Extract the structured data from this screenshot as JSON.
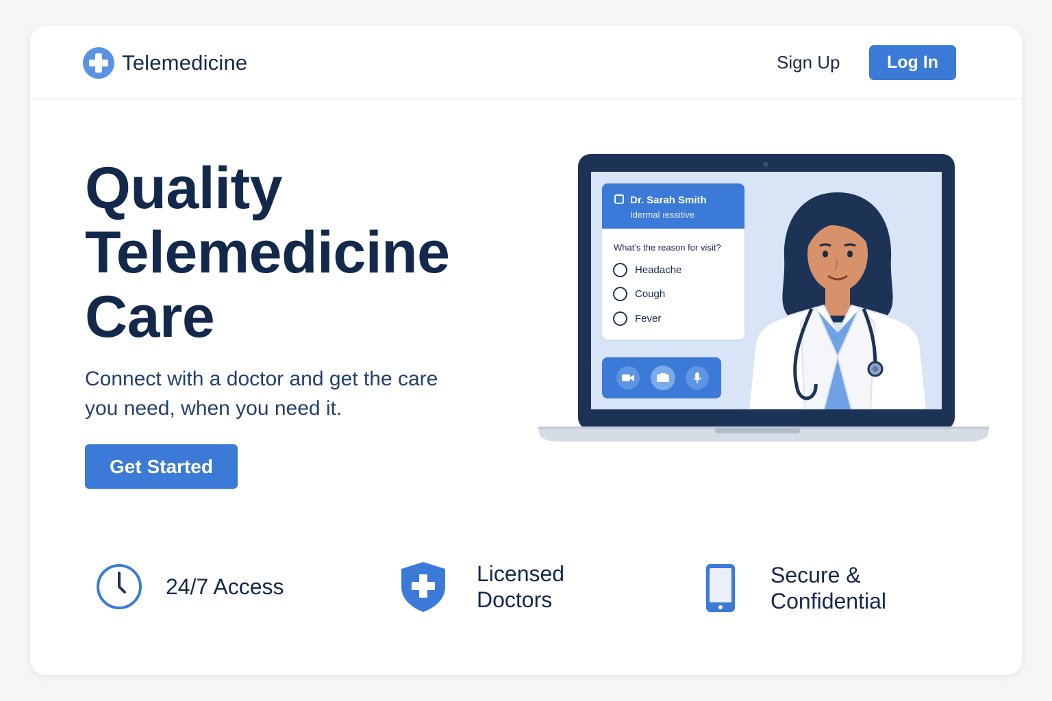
{
  "header": {
    "brand": "Telemedicine",
    "signup_label": "Sign Up",
    "login_label": "Log In"
  },
  "hero": {
    "title_lines": [
      "Quality",
      "Telemedicine",
      "Care"
    ],
    "subtitle_lines": [
      "Connect with a doctor and get the care",
      "you need, when you need it."
    ],
    "cta_label": "Get Started"
  },
  "illustration": {
    "doctor_name": "Dr. Sarah Smith",
    "doctor_specialty": "Idermal ıessitive",
    "question": "What’s the reason for visit?",
    "options": [
      "Headache",
      "Cough",
      "Fever"
    ],
    "controls": [
      "video-icon",
      "camera-icon",
      "microphone-icon"
    ]
  },
  "features": [
    {
      "icon": "clock-icon",
      "lines": [
        "24/7 Access"
      ]
    },
    {
      "icon": "shield-cross-icon",
      "lines": [
        "Licensed",
        "Doctors"
      ]
    },
    {
      "icon": "smartphone-icon",
      "lines": [
        "Secure &",
        "Confidential"
      ]
    }
  ],
  "colors": {
    "accent": "#3b7ad6",
    "heading": "#13294b",
    "background": "#f6f6f7",
    "bezel": "#1d3356"
  }
}
